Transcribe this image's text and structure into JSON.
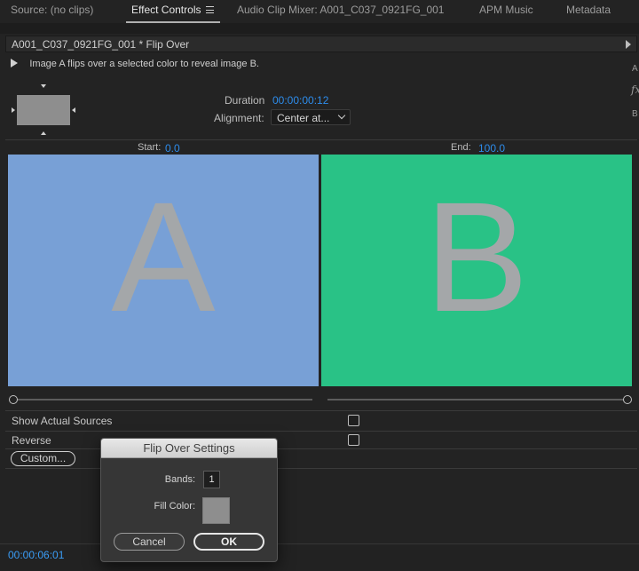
{
  "tabs": [
    {
      "label": "Source: (no clips)",
      "active": false
    },
    {
      "label": "Effect Controls",
      "active": true
    },
    {
      "label": "Audio Clip Mixer: A001_C037_0921FG_001",
      "active": false
    },
    {
      "label": "APM Music",
      "active": false
    },
    {
      "label": "Metadata",
      "active": false
    }
  ],
  "effect": {
    "clip_title": "A001_C037_0921FG_001 * Flip Over",
    "description": "Image A flips over a selected color to reveal image B.",
    "duration_label": "Duration",
    "duration_value": "00:00:00:12",
    "alignment_label": "Alignment:",
    "alignment_value": "Center at...",
    "start_label": "Start:",
    "start_value": "0.0",
    "end_label": "End:",
    "end_value": "100.0",
    "preview_a_letter": "A",
    "preview_b_letter": "B",
    "show_actual_sources_label": "Show Actual Sources",
    "reverse_label": "Reverse",
    "custom_button": "Custom..."
  },
  "side_letters": [
    "A",
    "B"
  ],
  "bottom": {
    "timecode": "00:00:06:01"
  },
  "dialog": {
    "title": "Flip Over Settings",
    "bands_label": "Bands:",
    "bands_value": "1",
    "fill_color_label": "Fill Color:",
    "fill_color": "#8e8e8e",
    "cancel_label": "Cancel",
    "ok_label": "OK"
  },
  "colors": {
    "accent_blue": "#2d8ceb",
    "preview_a": "#78a0d6",
    "preview_b": "#29c286"
  }
}
